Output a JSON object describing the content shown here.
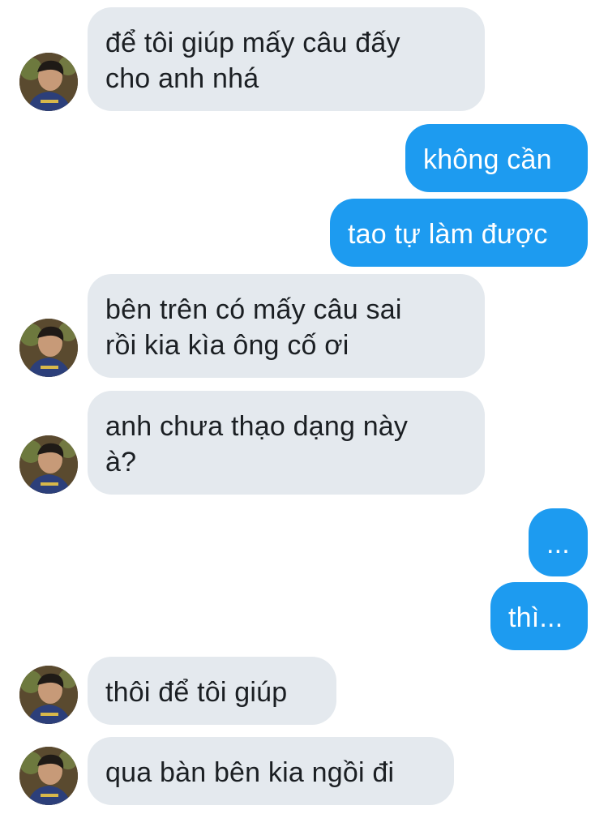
{
  "messages": [
    {
      "side": "in",
      "text": "để tôi giúp mấy câu đấy\ncho anh nhá",
      "avatar": true
    },
    {
      "side": "out",
      "text": "không cần"
    },
    {
      "side": "out",
      "text": "tao tự làm được"
    },
    {
      "side": "in",
      "text": "bên trên có mấy câu sai\nrồi kia kìa ông cố ơi",
      "avatar": true
    },
    {
      "side": "in",
      "text": "anh chưa thạo dạng này\nà?",
      "avatar": true
    },
    {
      "side": "out",
      "text": "..."
    },
    {
      "side": "out",
      "text": "thì..."
    },
    {
      "side": "in",
      "text": "thôi để tôi giúp",
      "avatar": true
    },
    {
      "side": "in",
      "text": "qua bàn bên kia ngồi đi",
      "avatar": true
    }
  ],
  "colors": {
    "incoming_bubble": "#e4e9ee",
    "outgoing_bubble": "#1d9bf0",
    "incoming_text": "#1b1f23",
    "outgoing_text": "#ffffff"
  },
  "icons": {
    "avatar": "user-avatar-photo"
  }
}
